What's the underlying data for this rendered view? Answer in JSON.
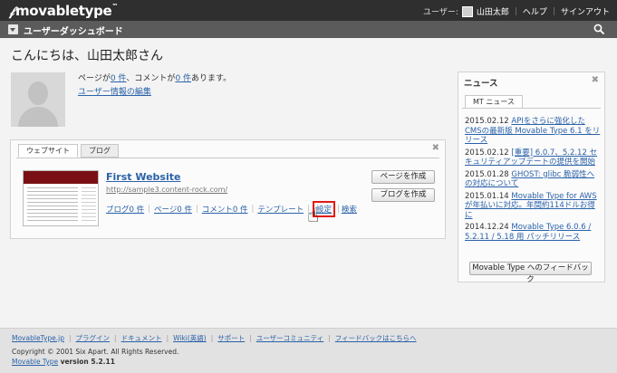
{
  "header": {
    "logo": "movabletype",
    "user_label": "ユーザー:",
    "user_name": "山田太郎",
    "help": "ヘルプ",
    "signout": "サインアウト"
  },
  "subbar": {
    "title": "ユーザーダッシュボード"
  },
  "greeting": "こんにちは、山田太郎さん",
  "profile": {
    "pages_prefix": "ページが",
    "pages_count": "0 件",
    "comments_prefix": "、コメントが",
    "comments_count": "0 件",
    "suffix": "あります。",
    "edit_link": "ユーザー情報の編集"
  },
  "sites_widget": {
    "tabs": [
      "ウェブサイト",
      "ブログ"
    ],
    "active_tab": 0,
    "site": {
      "name": "First Website",
      "url": "http://sample3.content-rock.com/",
      "links": [
        "ブログ0 件",
        "ページ0 件",
        "コメント0 件",
        "テンプレート",
        "設定",
        "検索"
      ]
    },
    "buttons": {
      "create_page": "ページを作成",
      "create_blog": "ブログを作成"
    }
  },
  "news": {
    "title": "ニュース",
    "tab": "MT ニュース",
    "items": [
      {
        "date": "2015.02.12",
        "title": "APIをさらに強化したCMSの最新版 Movable Type 6.1 をリリース"
      },
      {
        "date": "2015.02.12",
        "title": "[重要] 6.0.7、5.2.12 セキュリティアップデートの提供を開始"
      },
      {
        "date": "2015.01.28",
        "title": "GHOST: glibc 脆弱性への対応について"
      },
      {
        "date": "2015.01.14",
        "title": "Movable Type for AWS が年払いに対応。年間約114ドルお得に"
      },
      {
        "date": "2014.12.24",
        "title": "Movable Type 6.0.6 / 5.2.11 / 5.18 用 パッチリリース"
      }
    ],
    "feedback_button": "Movable Type へのフィードバック"
  },
  "footer": {
    "links": [
      "MovableType.jp",
      "プラグイン",
      "ドキュメント",
      "Wiki(英語)",
      "サポート",
      "ユーザーコミュニティ",
      "フィードバックはこちらへ"
    ],
    "copyright": "Copyright © 2001 Six Apart. All Rights Reserved.",
    "product": "Movable Type",
    "version": "version 5.2.11"
  }
}
